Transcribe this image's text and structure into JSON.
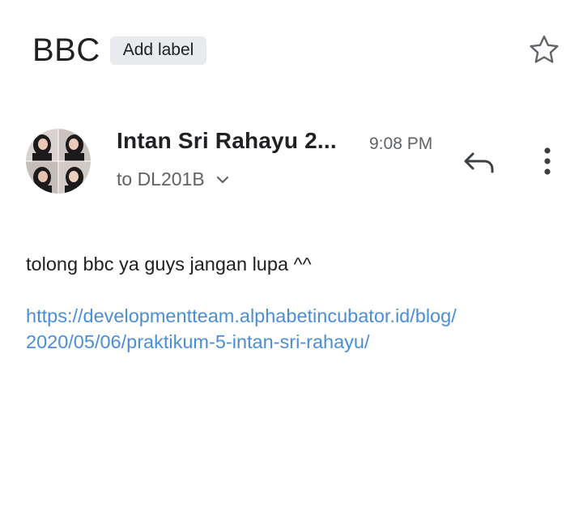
{
  "email": {
    "subject": "BBC",
    "label_chip": "Add label",
    "sender_name": "Intan Sri Rahayu 2...",
    "time": "9:08 PM",
    "recipient": "to DL201B",
    "body_text": "tolong bbc ya guys jangan lupa ^^",
    "link_line_1": "https://developmentteam.alphabetincubator.id/blog/",
    "link_line_2": "2020/05/06/praktikum-5-intan-sri-rahayu/"
  },
  "icons": {
    "star": "star-outline-icon",
    "reply": "reply-arrow-icon",
    "more": "more-vertical-icon",
    "chevron": "chevron-down-icon"
  },
  "colors": {
    "text_primary": "#202124",
    "text_secondary": "#5f6368",
    "link": "#4a8ed8",
    "chip_bg": "#e8eaed"
  }
}
